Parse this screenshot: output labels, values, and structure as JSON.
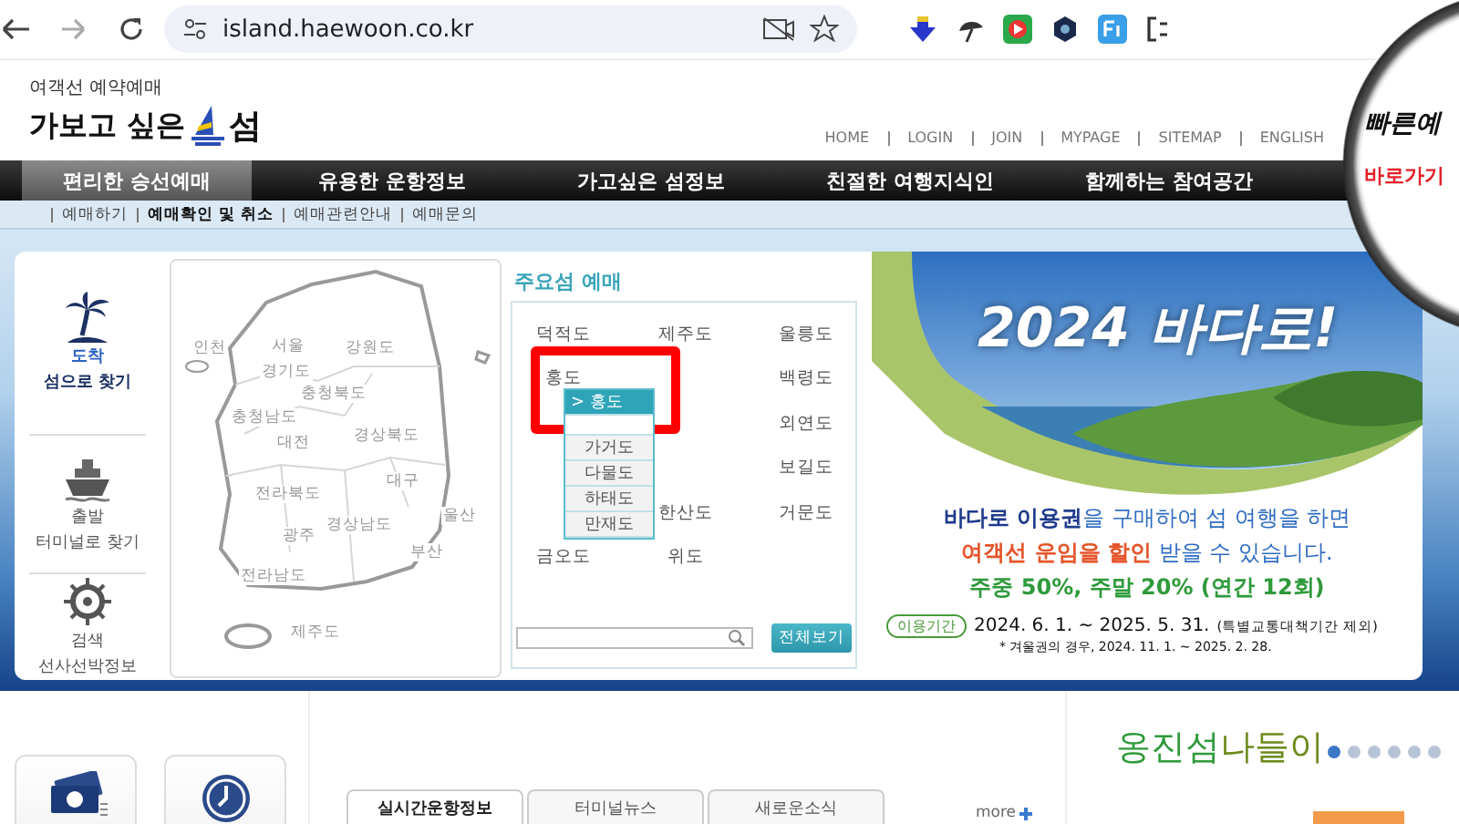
{
  "browser": {
    "url": "island.haewoon.co.kr"
  },
  "header": {
    "tagline": "여객선 예약예매",
    "logo_left": "가보고 싶은",
    "logo_right": "섬",
    "links": [
      "HOME",
      "LOGIN",
      "JOIN",
      "MYPAGE",
      "SITEMAP",
      "ENGLISH"
    ]
  },
  "quick": {
    "title": "빠른예",
    "subtitle": "바로가기"
  },
  "nav": [
    {
      "label": "편리한 승선예매",
      "selected": true
    },
    {
      "label": "유용한 운항정보",
      "selected": false
    },
    {
      "label": "가고싶은 섬정보",
      "selected": false
    },
    {
      "label": "친절한 여행지식인",
      "selected": false
    },
    {
      "label": "함께하는 참여공간",
      "selected": false
    }
  ],
  "subnav": [
    {
      "label": "예매하기",
      "selected": false
    },
    {
      "label": "예매확인 및 취소",
      "selected": true
    },
    {
      "label": "예매관련안내",
      "selected": false
    },
    {
      "label": "예매문의",
      "selected": false
    }
  ],
  "sidebar": [
    {
      "kind": "palm",
      "line1": "도착",
      "line2": "섬으로 찾기",
      "selected": true
    },
    {
      "kind": "ship",
      "line1": "출발",
      "line2": "터미널로 찾기",
      "selected": false
    },
    {
      "kind": "helm",
      "line1": "검색",
      "line2": "선사선박정보",
      "selected": false
    }
  ],
  "map": {
    "regions": [
      "인천",
      "서울",
      "강원도",
      "경기도",
      "충청북도",
      "충청남도",
      "대전",
      "경상북도",
      "대구",
      "전라북도",
      "울산",
      "경상남도",
      "광주",
      "부산",
      "전라남도",
      "제주도"
    ]
  },
  "islands": {
    "title": "주요섬 예매",
    "rows": [
      [
        "덕적도",
        "제주도",
        "울릉도"
      ],
      [
        "홍도",
        null,
        "백령도"
      ],
      [
        null,
        null,
        "외연도"
      ],
      [
        null,
        null,
        "보길도"
      ],
      [
        null,
        "한산도",
        "거문도"
      ],
      [
        "금오도",
        "위도",
        null
      ]
    ],
    "dropdown": [
      {
        "label": "> 홍도",
        "selected": true
      },
      {
        "label": "가거도",
        "selected": false
      },
      {
        "label": "다물도",
        "selected": false
      },
      {
        "label": "하태도",
        "selected": false
      },
      {
        "label": "만재도",
        "selected": false
      }
    ],
    "button": "전체보기"
  },
  "banner": {
    "title": "2024 바다로!",
    "lines": [
      [
        {
          "text": "바다로 이용권",
          "color": "#1f3b8c"
        },
        {
          "text": "을 구매하여 섬 여행을 하면",
          "color": "#2f6cc0"
        }
      ],
      [
        {
          "text": "여객선 운임을 할인",
          "color": "#e5552b"
        },
        {
          "text": " 받을 수 있습니다.",
          "color": "#2f6cc0"
        }
      ],
      [
        {
          "text": "주중 50%, 주말 20% (연간 12회)",
          "color": "#2f9a3b"
        }
      ]
    ],
    "period_label": "이용기간",
    "period": "2024. 6. 1. ~ 2025. 5. 31.",
    "period_note": "(특별교통대책기간 제외)",
    "footnote": "* 겨울권의 경우, 2024. 11. 1. ~ 2025. 2. 28."
  },
  "bottom": {
    "tabs": [
      {
        "label": "실시간운항정보",
        "selected": true
      },
      {
        "label": "터미널뉴스",
        "selected": false
      },
      {
        "label": "새로운소식",
        "selected": false
      }
    ],
    "more": "more",
    "promo": [
      {
        "text": "옹진섬",
        "color": "#2f9a3b"
      },
      {
        "text": "나들이",
        "color": "#6c8a1c"
      }
    ],
    "dots": [
      {
        "selected": true
      },
      {
        "selected": false
      },
      {
        "selected": false
      },
      {
        "selected": false
      },
      {
        "selected": false
      },
      {
        "selected": false
      }
    ]
  }
}
